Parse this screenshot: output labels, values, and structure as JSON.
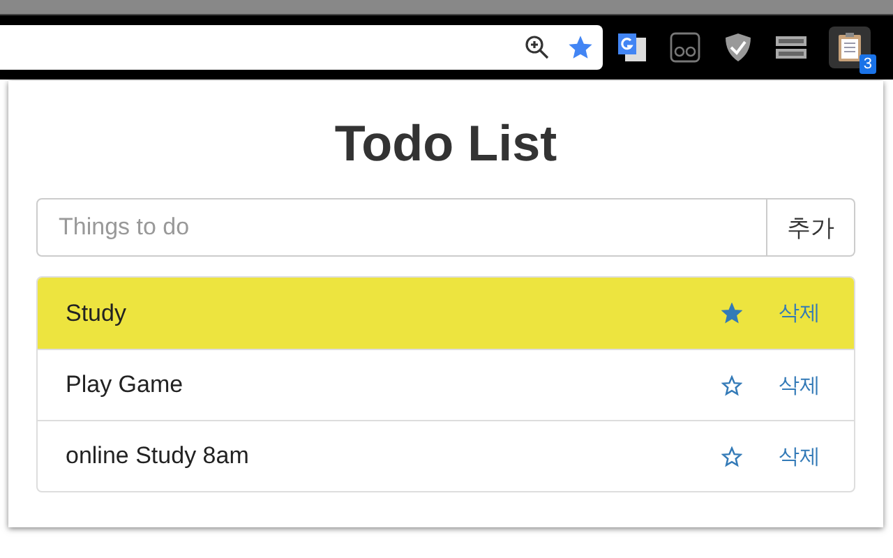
{
  "toolbar": {
    "badge": "3"
  },
  "popup": {
    "title": "Todo List",
    "input": {
      "placeholder": "Things to do"
    },
    "add_button": "추가",
    "items": [
      {
        "text": "Study",
        "starred": true,
        "delete": "삭제"
      },
      {
        "text": "Play Game",
        "starred": false,
        "delete": "삭제"
      },
      {
        "text": "online Study 8am",
        "starred": false,
        "delete": "삭제"
      }
    ]
  }
}
